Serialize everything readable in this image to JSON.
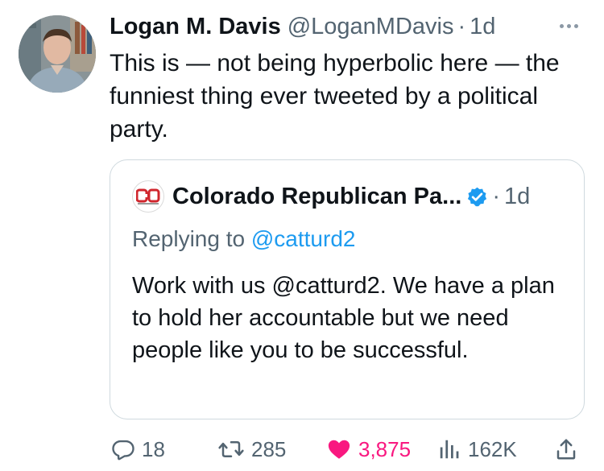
{
  "tweet": {
    "author_name": "Logan M. Davis",
    "author_handle": "@LoganMDavis",
    "separator": "·",
    "time": "1d",
    "text": "This is — not being hyperbolic here — the funniest thing ever tweeted by a political party."
  },
  "quote": {
    "logo_text": "CO",
    "author_name": "Colorado Republican Pa...",
    "separator": "·",
    "time": "1d",
    "replying_prefix": "Replying to",
    "replying_handle": "@catturd2",
    "text": "Work with us @catturd2. We have a plan to hold her accountable but we need people like you to be successful."
  },
  "actions": {
    "replies": "18",
    "retweets": "285",
    "likes": "3,875",
    "views": "162K"
  },
  "icons": {
    "more": "more-dots-icon",
    "verified": "verified-badge-icon",
    "reply": "reply-bubble-icon",
    "retweet": "retweet-icon",
    "like": "heart-icon",
    "views": "views-bar-icon",
    "share": "share-icon"
  },
  "colors": {
    "accent": "#1d9bf0",
    "like": "#f91880",
    "muted": "#536471",
    "text": "#0f1419",
    "border": "#cfd9de",
    "brand_red": "#d0262d"
  }
}
